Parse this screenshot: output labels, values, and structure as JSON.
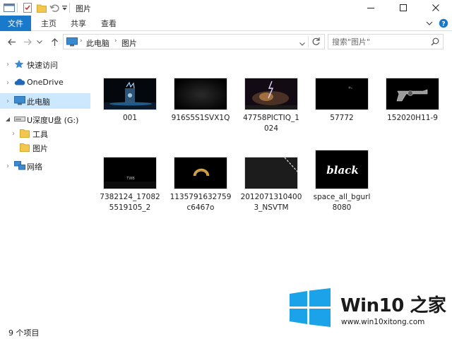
{
  "window": {
    "title": "图片",
    "controls": {
      "minimize_icon": "minimize-icon",
      "maximize_icon": "maximize-icon",
      "close_icon": "close-icon"
    }
  },
  "ribbon": {
    "tabs": [
      {
        "label": "文件",
        "active": true
      },
      {
        "label": "主页"
      },
      {
        "label": "共享"
      },
      {
        "label": "查看"
      }
    ]
  },
  "address": {
    "breadcrumb": [
      "此电脑",
      "图片"
    ],
    "search_placeholder": "搜索\"图片\""
  },
  "nav": {
    "items": [
      {
        "label": "快速访问",
        "icon": "star-icon"
      },
      {
        "label": "OneDrive",
        "icon": "cloud-icon"
      },
      {
        "label": "此电脑",
        "icon": "computer-icon",
        "selected": true
      },
      {
        "label": "U深度U盘 (G:)",
        "icon": "usb-drive-icon"
      },
      {
        "label": "工具",
        "icon": "folder-icon"
      },
      {
        "label": "图片",
        "icon": "folder-icon"
      },
      {
        "label": "网络",
        "icon": "network-icon"
      }
    ]
  },
  "files": [
    {
      "line1": "001",
      "line2": ""
    },
    {
      "line1": "916S5S1SVX1Q",
      "line2": ""
    },
    {
      "line1": "47758PICTIQ_1",
      "line2": "024"
    },
    {
      "line1": "57772",
      "line2": ""
    },
    {
      "line1": "152020H11-9",
      "line2": ""
    },
    {
      "line1": "7382124_17082",
      "line2": "5519105_2"
    },
    {
      "line1": "1135791632759",
      "line2": "c6467o"
    },
    {
      "line1": "2012071310400",
      "line2": "3_NSVTM"
    },
    {
      "line1": "space_all_bgurl",
      "line2": "8080"
    }
  ],
  "thumb_texts": {
    "black": "black",
    "small": "TWB"
  },
  "status": {
    "count": "9 个项目"
  },
  "watermark": {
    "brand": "Win10 之家",
    "url": "www.win10xitong.com"
  },
  "colors": {
    "accent": "#1979ca",
    "selected": "#cce8ff",
    "folder": "#f3c74d",
    "logo": "#1aa3e8"
  }
}
